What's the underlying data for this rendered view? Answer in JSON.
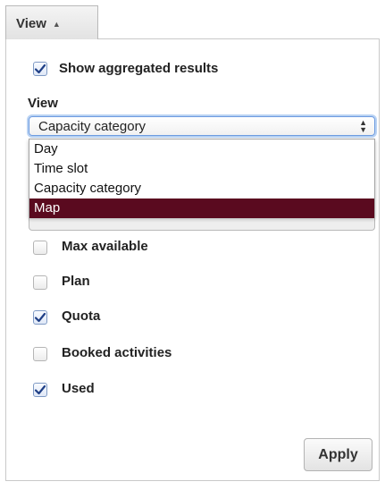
{
  "header": {
    "view_button_label": "View",
    "caret_glyph": "▲"
  },
  "aggregated": {
    "label": "Show aggregated results",
    "checked": true
  },
  "view_field": {
    "label": "View",
    "selected_value": "Capacity category",
    "arrows_up": "▲",
    "arrows_down": "▼",
    "options": [
      "Day",
      "Time slot",
      "Capacity category",
      "Map"
    ],
    "highlighted_option": "Map"
  },
  "options": [
    {
      "label": "Max available",
      "checked": false
    },
    {
      "label": "Plan",
      "checked": false
    },
    {
      "label": "Quota",
      "checked": true
    },
    {
      "label": "Booked activities",
      "checked": false
    },
    {
      "label": "Used",
      "checked": true
    }
  ],
  "footer": {
    "apply_label": "Apply"
  },
  "colors": {
    "highlight_bg": "#5a0a1f",
    "checkmark": "#1f3f86"
  }
}
